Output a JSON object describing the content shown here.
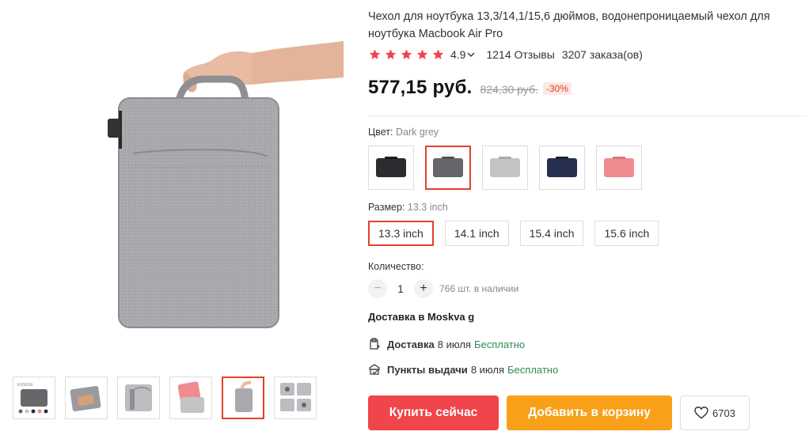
{
  "product": {
    "title": "Чехол для ноутбука 13,3/14,1/15,6 дюймов, водонепроницаемый чехол для ноутбука Macbook Air Pro",
    "rating_value": "4.9",
    "reviews": "1214 Отзывы",
    "orders": "3207 заказа(ов)",
    "stars": 5,
    "price": "577,15 руб.",
    "old_price": "824,30 руб.",
    "discount": "-30%"
  },
  "color": {
    "label": "Цвет:",
    "selected": "Dark grey",
    "options": [
      {
        "name": "black",
        "color": "#2b2c30"
      },
      {
        "name": "dark-grey",
        "color": "#66676b"
      },
      {
        "name": "light-grey",
        "color": "#c4c4c6"
      },
      {
        "name": "navy",
        "color": "#262f4d"
      },
      {
        "name": "pink",
        "color": "#ee8c90"
      }
    ],
    "selected_index": 1
  },
  "size": {
    "label": "Размер:",
    "selected": "13.3 inch",
    "options": [
      "13.3 inch",
      "14.1 inch",
      "15.4 inch",
      "15.6 inch"
    ],
    "selected_index": 0
  },
  "quantity": {
    "label": "Количество:",
    "minus": "−",
    "plus": "+",
    "value": "1",
    "stock": "766 шт. в наличии"
  },
  "delivery": {
    "heading": "Доставка в Moskva g",
    "rows": [
      {
        "label": "Доставка",
        "date": "8 июля",
        "price": "Бесплатно",
        "icon": "parcel-icon"
      },
      {
        "label": "Пункты выдачи",
        "date": "8 июля",
        "price": "Бесплатно",
        "icon": "pickup-point-icon"
      }
    ]
  },
  "actions": {
    "buy_now": "Купить сейчас",
    "add_to_cart": "Добавить в корзину",
    "wishlist_count": "6703"
  },
  "gallery": {
    "thumbnails": [
      "thumb-1",
      "thumb-2",
      "thumb-3",
      "thumb-4",
      "thumb-5",
      "thumb-6"
    ],
    "active_index": 4,
    "thumb_brand_text": "ENSIGN"
  },
  "colors": {
    "accent": "#e2412a",
    "star": "#f0454a",
    "buy": "#f0454a",
    "cart": "#f8a019",
    "free": "#2e8b57"
  }
}
